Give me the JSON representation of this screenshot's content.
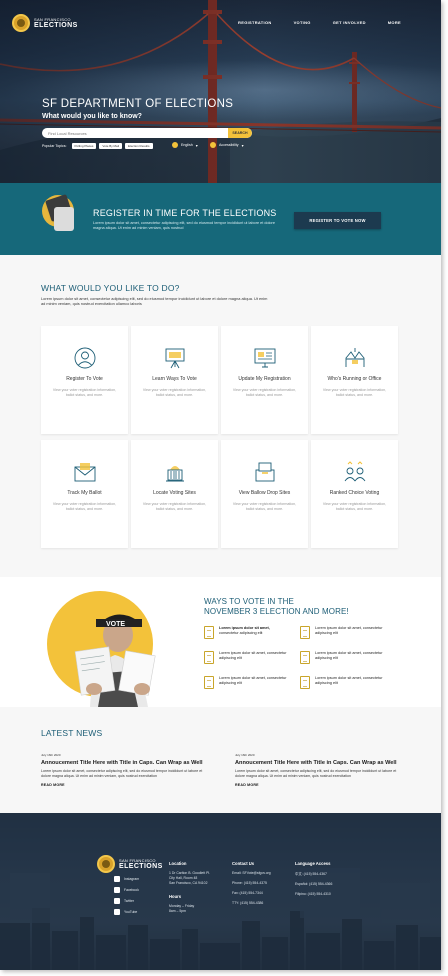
{
  "header": {
    "logo_line1": "SAN FRANCISCO",
    "logo_line2": "ELECTIONS",
    "nav": [
      "REGISTRATION",
      "VOTING",
      "GET INVOLVED",
      "MORE"
    ]
  },
  "hero": {
    "title": "SF DEPARTMENT OF ELECTIONS",
    "subtitle": "What would you like to know?",
    "search_placeholder": "Find Local Resources",
    "search_button": "SEARCH",
    "popular_label": "Popular Topics:",
    "popular_topics": [
      "Polling Places",
      "Vote By Mail",
      "Election Results"
    ],
    "language": "English",
    "accessibility": "Accessibility"
  },
  "register": {
    "title": "REGISTER IN TIME FOR THE ELECTIONS",
    "text": "Lorem ipsum dolor sit amet, consectetur adipiscing elit, sed do eiusmod tempor incididunt ut labore et dolore magna aliqua. Ut enim ad minim veniam, quis nostrud",
    "button": "REGISTER TO VOTE NOW"
  },
  "actions": {
    "title": "WHAT WOULD YOU LIKE TO DO?",
    "desc": "Lorem ipsum dolor sit amet, consectetur adipiscing elit, sed do eiusmod tempor incididunt ut labore et dolore magna aliqua. Ut enim ad minim veniam, quis nostrud exercitation ullamco laboris",
    "cards": [
      {
        "title": "Register To Vote",
        "desc": "View your voter registration information, ballot status, and more.",
        "icon": "user-circle-icon"
      },
      {
        "title": "Learn Ways To Vote",
        "desc": "View your voter registration information, ballot status, and more.",
        "icon": "presentation-board-icon"
      },
      {
        "title": "Update My Registration",
        "desc": "View your voter registration information, ballot status, and more.",
        "icon": "computer-form-icon"
      },
      {
        "title": "Who's Running or Office",
        "desc": "View your voter registration information, ballot status, and more.",
        "icon": "podium-icon"
      },
      {
        "title": "Track My Ballot",
        "desc": "View your voter registration information, ballot status, and more.",
        "icon": "envelope-icon"
      },
      {
        "title": "Locate Voting Sites",
        "desc": "View your voter registration information, ballot status, and more.",
        "icon": "capitol-building-icon"
      },
      {
        "title": "View Ballow Drop Sites",
        "desc": "View your voter registration information, ballot status, and more.",
        "icon": "ballot-box-icon"
      },
      {
        "title": "Ranked Choice Voting",
        "desc": "View your voter registration information, ballot status, and more.",
        "icon": "ranked-people-icon"
      }
    ]
  },
  "ways": {
    "title_line1": "WAYS TO VOTE IN THE",
    "title_line2": "NOVEMBER 3 ELECTION AND MORE!",
    "cap_text": "VOTE",
    "items": [
      {
        "bold": "Lorem ipsum dolor sit amet,",
        "text": "consectetur adipiscing elit"
      },
      {
        "bold": "",
        "text": "Lorem ipsum dolor sit amet, consectetur adipiscing elit"
      },
      {
        "bold": "",
        "text": "Lorem ipsum dolor sit amet, consectetur adipiscing elit"
      },
      {
        "bold": "",
        "text": "Lorem ipsum dolor sit amet, consectetur adipiscing elit"
      },
      {
        "bold": "",
        "text": "Lorem ipsum dolor sit amet, consectetur adipiscing elit"
      },
      {
        "bold": "",
        "text": "Lorem ipsum dolor sit amet, consectetur adipiscing elit"
      }
    ]
  },
  "news": {
    "title": "LATEST NEWS",
    "articles": [
      {
        "date": "July 16th 2020",
        "headline": "Annoucement Title Here with Title in Caps. Can Wrap as Well",
        "body": "Lorem ipsum dolor sit amet, consectetur adipiscing elit, sed do eiusmod tempor incididunt ut labore et dolore magna aliqua. Ut enim ad minim veniam, quis nostrud exercitation",
        "more": "READ MORE"
      },
      {
        "date": "July 16th 2020",
        "headline": "Annoucement Title Here with Title in Caps. Can Wrap as Well",
        "body": "Lorem ipsum dolor sit amet, consectetur adipiscing elit, sed do eiusmod tempor incididunt ut labore et dolore magna aliqua. Ut enim ad minim veniam, quis nostrud exercitation",
        "more": "READ MORE"
      }
    ]
  },
  "footer": {
    "social": [
      "Instagram",
      "Facebook",
      "Twitter",
      "YouTube"
    ],
    "location_head": "Location",
    "location": [
      "1 Dr Carlton B. Goodlett Pl.",
      "City Hall, Room 48",
      "San Francisco, CA 94102"
    ],
    "hours_head": "Hours",
    "hours": [
      "Monday – Friday",
      "8am – 5pm"
    ],
    "contact_head": "Contact Us",
    "contact": [
      "Email: SFVote@sfgov.org",
      "Phone: (415) 554-4375",
      "Fax: (415) 554-7344",
      "TTY: (415) 554-4386"
    ],
    "lang_head": "Language Access",
    "lang": [
      "中文: (415) 554-4367",
      "Español: (415) 554-4366",
      "Filipino: (415) 554-4310"
    ]
  }
}
